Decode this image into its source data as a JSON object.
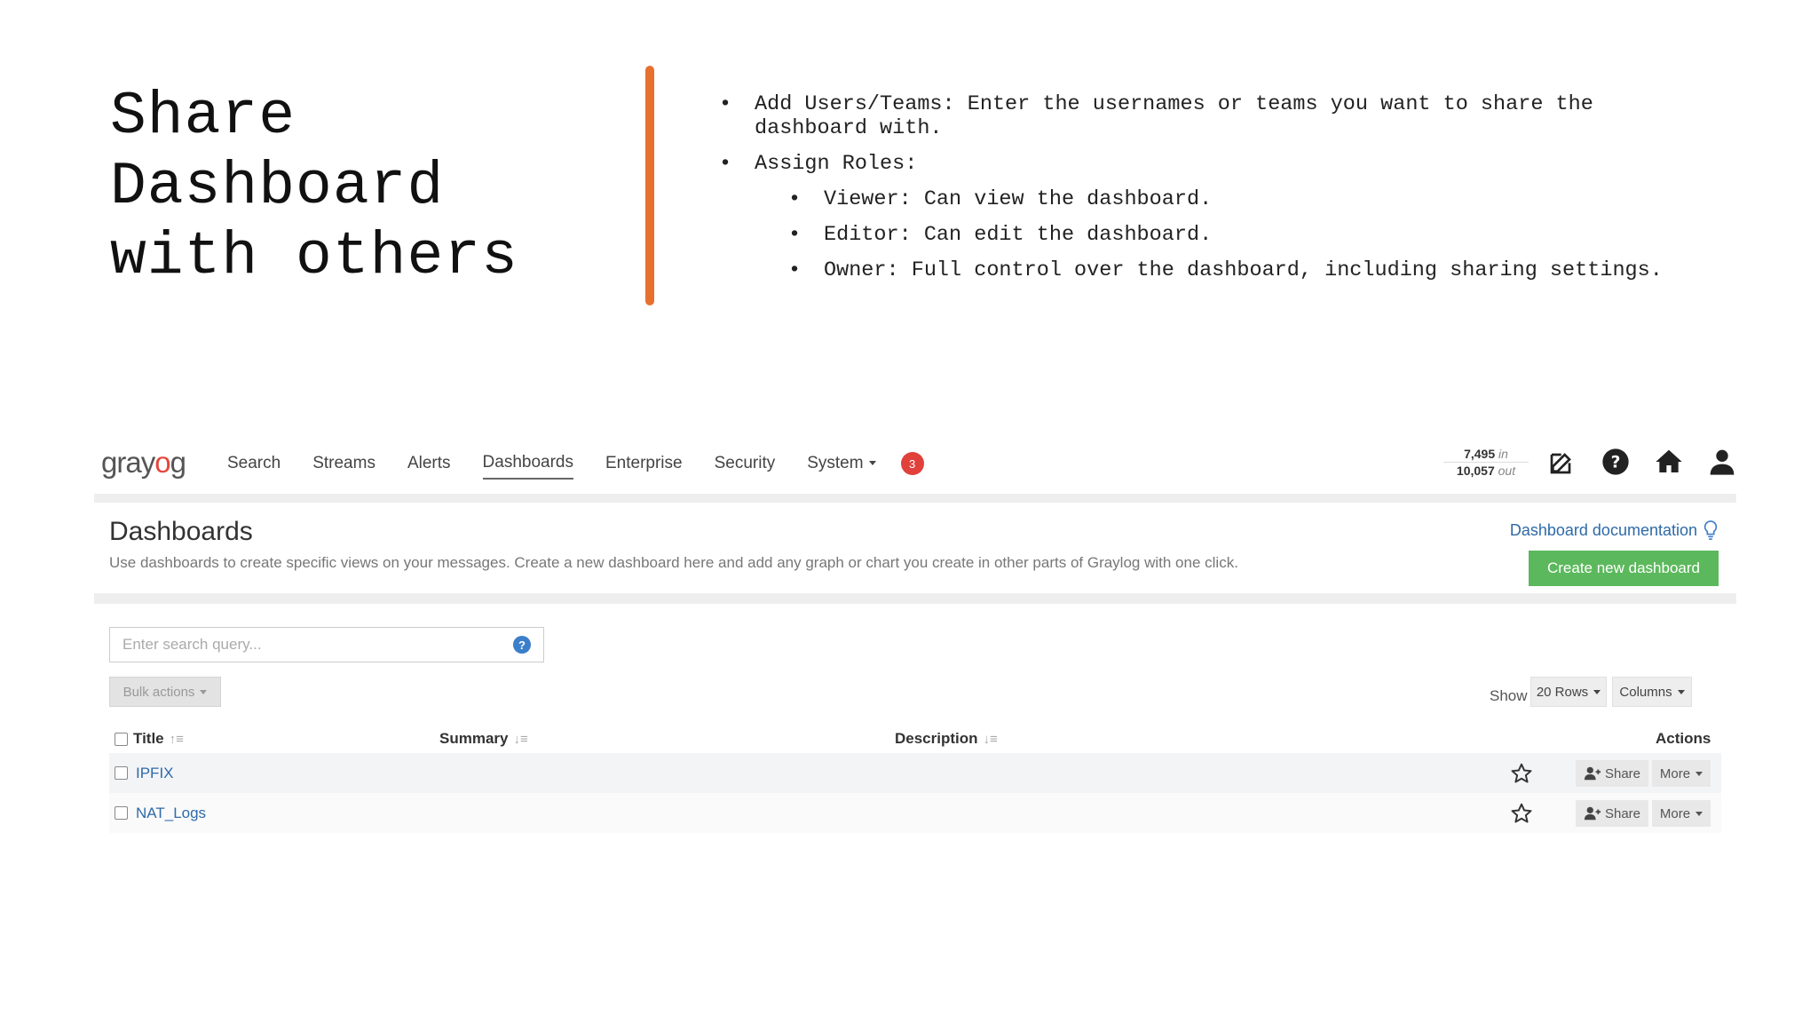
{
  "slide": {
    "title": "Share\nDashboard\nwith others",
    "bullets": {
      "add_users": "Add Users/Teams: Enter the usernames or teams you want to share the dashboard with.",
      "assign_roles": "Assign Roles:",
      "roles": [
        "Viewer: Can view the dashboard.",
        "Editor: Can edit the dashboard.",
        "Owner: Full control over the dashboard, including sharing settings."
      ]
    },
    "accent_color": "#e8702f"
  },
  "app": {
    "logo": {
      "left": "gray",
      "o": "o",
      "right": "g"
    },
    "nav": [
      {
        "label": "Search"
      },
      {
        "label": "Streams"
      },
      {
        "label": "Alerts"
      },
      {
        "label": "Dashboards"
      },
      {
        "label": "Enterprise"
      },
      {
        "label": "Security"
      },
      {
        "label": "System"
      }
    ],
    "notification_count": "3",
    "throughput": {
      "in_value": "7,495",
      "in_label": "in",
      "out_value": "10,057",
      "out_label": "out"
    },
    "page": {
      "title": "Dashboards",
      "description": "Use dashboards to create specific views on your messages. Create a new dashboard here and add any graph or chart you create in other parts of Graylog with one click.",
      "doc_link": "Dashboard documentation",
      "create_button": "Create new dashboard"
    },
    "search": {
      "placeholder": "Enter search query...",
      "help": "?"
    },
    "bulk_actions": "Bulk actions",
    "show_label": "Show",
    "rows_button": "20 Rows",
    "columns_button": "Columns",
    "table": {
      "headers": {
        "title": "Title",
        "summary": "Summary",
        "description": "Description",
        "actions": "Actions"
      },
      "rows": [
        {
          "title": "IPFIX",
          "share": "Share",
          "more": "More"
        },
        {
          "title": "NAT_Logs",
          "share": "Share",
          "more": "More"
        }
      ]
    },
    "colors": {
      "primary_link": "#2e6aa8",
      "success": "#5cb85c",
      "badge": "#e0413b"
    }
  }
}
